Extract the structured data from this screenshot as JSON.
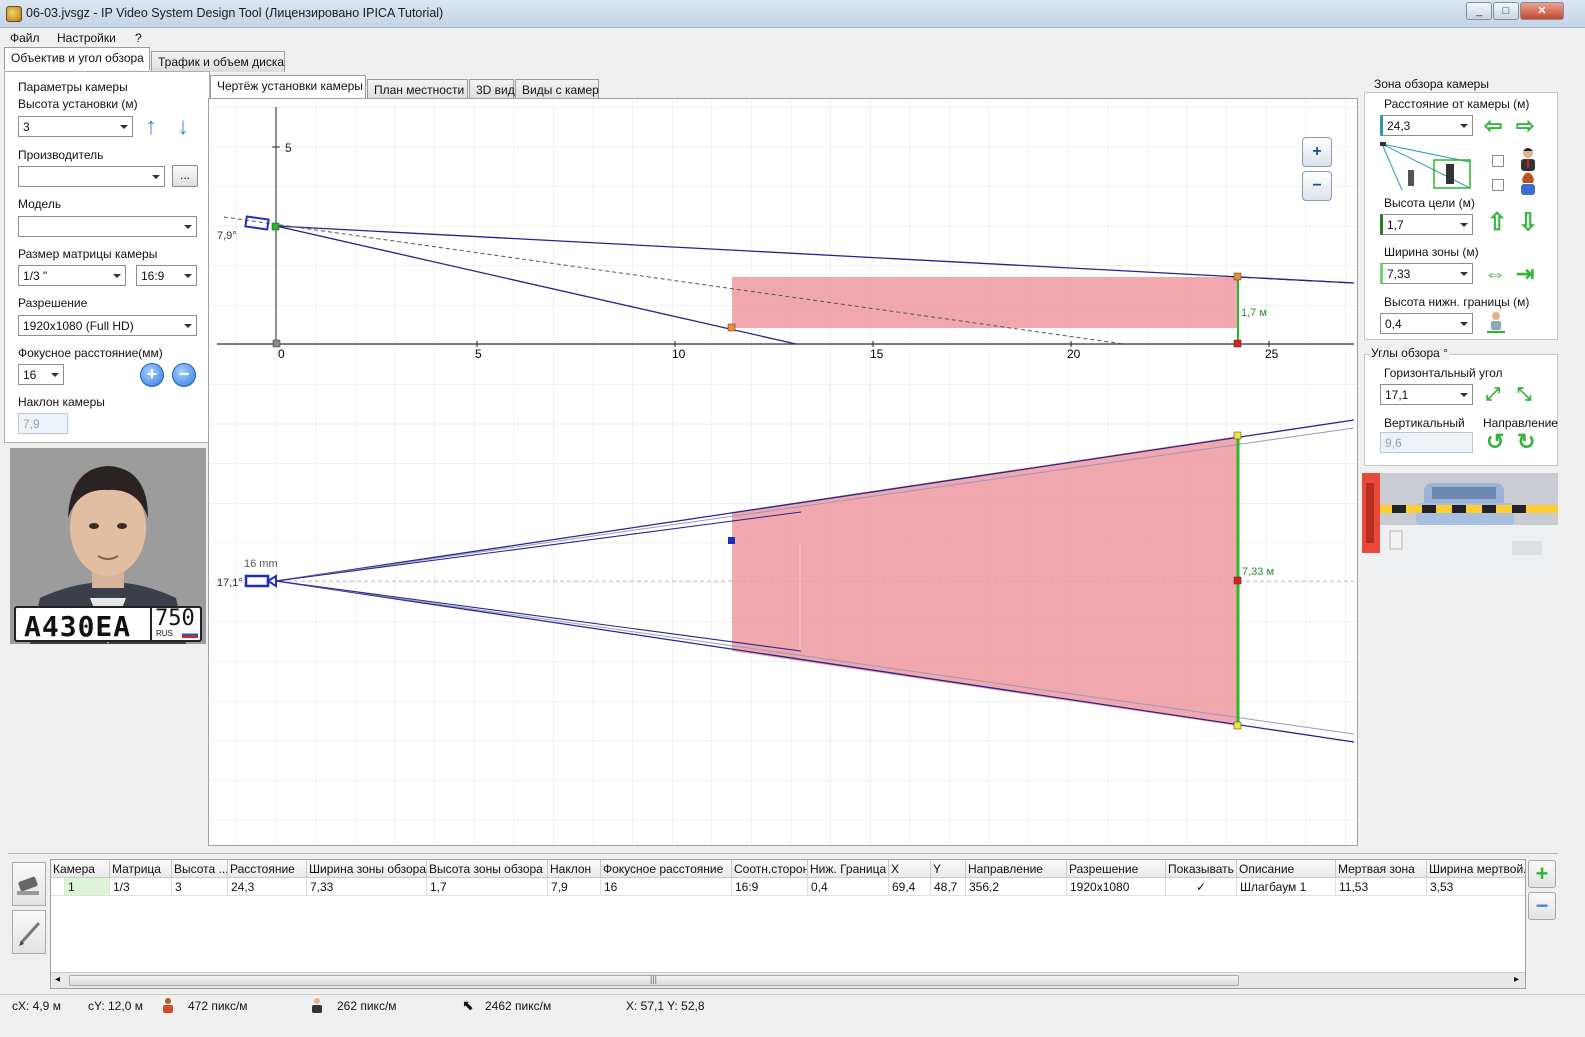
{
  "window": {
    "title": "06-03.jvsgz - IP Video System Design Tool (Лицензировано  IPICA Tutorial)",
    "controls": [
      "_",
      "□",
      "✕"
    ]
  },
  "menu": [
    "Файл",
    "Настройки",
    "?"
  ],
  "left_tabs": [
    "Объектив и угол обзора",
    "Трафик и объем диска"
  ],
  "left_panel": {
    "group_title": "Параметры камеры",
    "height_label": "Высота установки (м)",
    "height_value": "3",
    "manufacturer_label": "Производитель",
    "manufacturer_value": "",
    "browse_label": "...",
    "model_label": "Модель",
    "model_value": "",
    "matrix_label": "Размер матрицы камеры",
    "matrix_value": "1/3 \"",
    "aspect_value": "16:9",
    "resolution_label": "Разрешение",
    "resolution_value": "1920x1080 (Full HD)",
    "focal_label": "Фокусное расстояние(мм)",
    "focal_value": "16",
    "tilt_label": "Наклон камеры",
    "tilt_value": "7,9",
    "plate_text": "A430EA",
    "plate_region": "750",
    "plate_country": "RUS"
  },
  "center_tabs": [
    "Чертёж установки камеры",
    "План местности",
    "3D вид",
    "Виды с камер"
  ],
  "drawing": {
    "side_y_tick": "5",
    "x_ticks": [
      "0",
      "5",
      "10",
      "15",
      "20",
      "25"
    ],
    "tilt_label": "7,9°",
    "target_height_label": "1,7 м",
    "focal_label": "16 mm",
    "hfov_label": "17,1°",
    "zone_width_label": "7,33 м",
    "zoom_in": "+",
    "zoom_out": "−"
  },
  "right_panel": {
    "zone_title": "Зона обзора камеры",
    "distance_label": "Расстояние от камеры (м)",
    "distance_value": "24,3",
    "target_height_label": "Высота цели (м)",
    "target_height_value": "1,7",
    "zone_width_label": "Ширина зоны (м)",
    "zone_width_value": "7,33",
    "lower_bound_label": "Высота нижн. границы (м)",
    "lower_bound_value": "0,4",
    "angles_title": "Углы обзора °",
    "horizontal_label": "Горизонтальный угол",
    "horizontal_value": "17,1",
    "vertical_label": "Вертикальный",
    "vertical_value": "9,6",
    "direction_label": "Направление"
  },
  "table": {
    "headers": [
      "Камера",
      "Матрица",
      "Высота ...",
      "Расстояние",
      "Ширина зоны обзора",
      "Высота зоны обзора",
      "Наклон",
      "Фокусное расстояние",
      "Соотн.сторон",
      "Ниж. Граница",
      "X",
      "Y",
      "Направление",
      "Разрешение",
      "Показывать",
      "Описание",
      "Мертвая зона",
      "Ширина мертвой..."
    ],
    "row": [
      "1",
      "1/3",
      "3",
      "24,3",
      "7,33",
      "1,7",
      "7,9",
      "16",
      "16:9",
      "0,4",
      "69,4",
      "48,7",
      "356,2",
      "1920x1080",
      "✓",
      "Шлагбаум 1",
      "11,53",
      "3,53"
    ],
    "scroll_grip": "|||"
  },
  "statusbar": {
    "cx": "cX: 4,9 м",
    "cy": "cY: 12,0 м",
    "px1": "472 пикс/м",
    "px2": "262 пикс/м",
    "px3": "2462 пикс/м",
    "xy": "X: 57,1 Y: 52,8"
  },
  "colors": {
    "zone_fill": "#ef9aa1",
    "fov_line": "#24248f",
    "target_line": "#2ab82a",
    "grid": "#e2e2ea",
    "accent_blue": "#2f7be0",
    "accent_green": "#35b43a"
  }
}
